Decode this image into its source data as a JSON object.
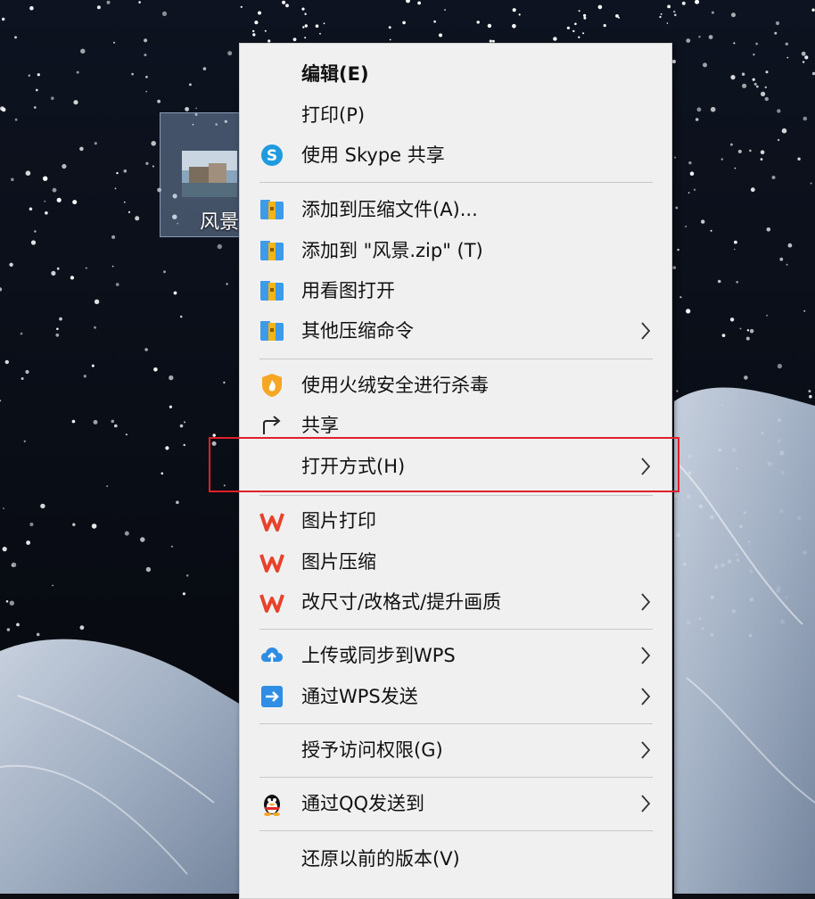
{
  "file": {
    "name": "风景"
  },
  "menu": {
    "items": [
      {
        "label": "编辑(E)",
        "bold": true,
        "icon": "none",
        "submenu": false
      },
      {
        "label": "打印(P)",
        "icon": "none",
        "submenu": false
      },
      {
        "label": "使用 Skype 共享",
        "icon": "skype-icon",
        "submenu": false
      },
      {
        "label": "添加到压缩文件(A)...",
        "icon": "archive-icon",
        "submenu": false
      },
      {
        "label": "添加到 \"风景.zip\" (T)",
        "icon": "archive-icon",
        "submenu": false
      },
      {
        "label": "用看图打开",
        "icon": "archive-icon",
        "submenu": false
      },
      {
        "label": "其他压缩命令",
        "icon": "archive-icon",
        "submenu": true
      },
      {
        "label": "使用火绒安全进行杀毒",
        "icon": "huorong-shield-icon",
        "submenu": false
      },
      {
        "label": "共享",
        "icon": "share-icon",
        "submenu": false
      },
      {
        "label": "打开方式(H)",
        "icon": "none",
        "submenu": true,
        "highlighted": true
      },
      {
        "label": "图片打印",
        "icon": "wps-icon",
        "submenu": false
      },
      {
        "label": "图片压缩",
        "icon": "wps-icon",
        "submenu": false
      },
      {
        "label": "改尺寸/改格式/提升画质",
        "icon": "wps-icon",
        "submenu": true
      },
      {
        "label": "上传或同步到WPS",
        "icon": "cloud-upload-icon",
        "submenu": true
      },
      {
        "label": "通过WPS发送",
        "icon": "wps-send-icon",
        "submenu": true
      },
      {
        "label": "授予访问权限(G)",
        "icon": "none",
        "submenu": true
      },
      {
        "label": "通过QQ发送到",
        "icon": "qq-penguin-icon",
        "submenu": true
      },
      {
        "label": "还原以前的版本(V)",
        "icon": "none",
        "submenu": false
      }
    ]
  },
  "colors": {
    "menu_background": "#f0f0f0",
    "highlight_border": "#e0202a",
    "wps_red": "#e8412c",
    "skype_blue": "#1e9be0",
    "archive_blue": "#3d9be8",
    "archive_yellow": "#f2b417"
  }
}
